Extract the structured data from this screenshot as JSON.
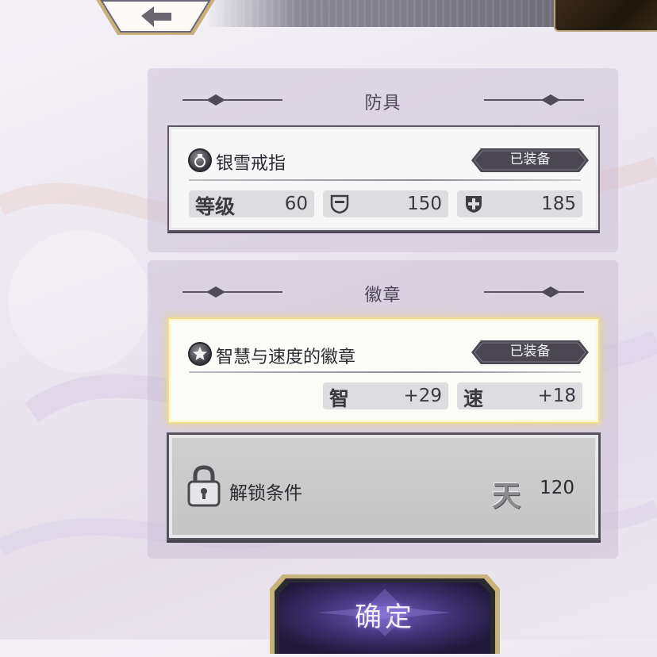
{
  "header": {
    "back_icon": "left-arrow-icon"
  },
  "armor_section": {
    "title": "防具",
    "item": {
      "icon": "ring-icon",
      "name": "银雪戒指",
      "status": "已装备",
      "stats": [
        {
          "label": "等级",
          "value": "60"
        },
        {
          "icon": "shield-outline-icon",
          "value": "150"
        },
        {
          "icon": "shield-cross-icon",
          "value": "185"
        }
      ]
    }
  },
  "badge_section": {
    "title": "徽章",
    "item": {
      "icon": "star-badge-icon",
      "name": "智慧与速度的徽章",
      "status": "已装备",
      "stats": [
        {
          "label": "智",
          "value": "+29"
        },
        {
          "label": "速",
          "value": "+18"
        }
      ]
    },
    "locked_slot": {
      "icon": "lock-icon",
      "label": "解锁条件",
      "requirement_glyph": "天",
      "requirement_value": "120"
    }
  },
  "footer": {
    "confirm_label": "确定"
  },
  "colors": {
    "panel_bg": "#c4b8ce",
    "tag_bg": "#4a4752",
    "highlight_glow": "#f0dc8a",
    "confirm_bg": "#3b2d6b"
  }
}
